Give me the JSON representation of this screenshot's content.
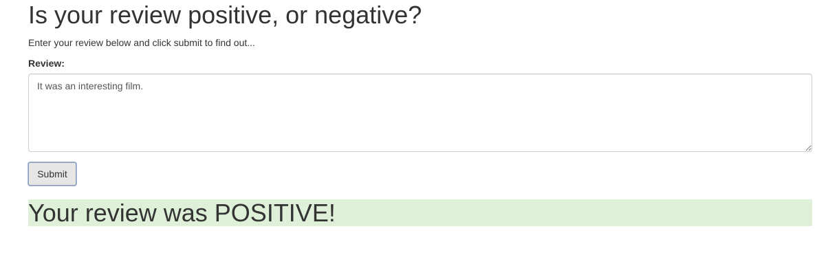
{
  "page": {
    "title": "Is your review positive, or negative?",
    "intro": "Enter your review below and click submit to find out..."
  },
  "form": {
    "review_label": "Review:",
    "review_value": "It was an interesting film.",
    "submit_label": "Submit"
  },
  "result": {
    "message": "Your review was POSITIVE!",
    "sentiment": "POSITIVE",
    "background_color": "#dff0d8"
  }
}
